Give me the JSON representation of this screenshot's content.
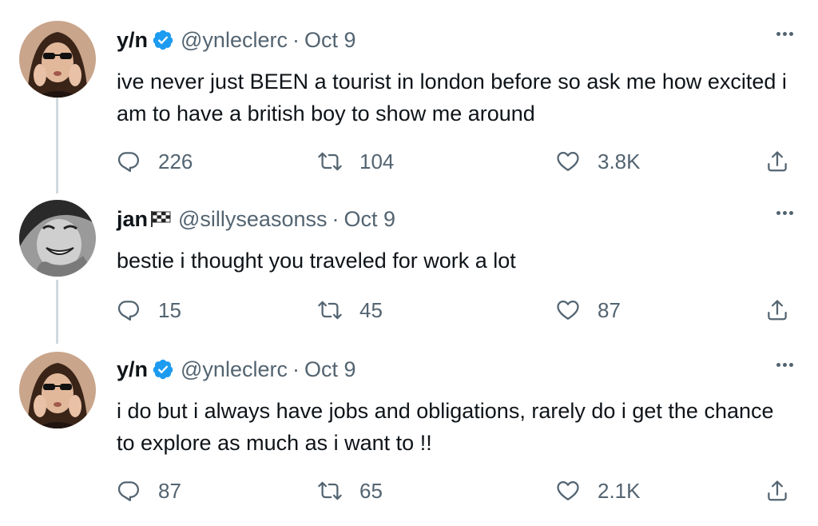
{
  "tweets": [
    {
      "name": "y/n",
      "handle": "@ynleclerc",
      "dot": "·",
      "date": "Oct 9",
      "verified": true,
      "text": "ive never just BEEN a tourist in london before so ask me how excited i am to have a british boy to show me around",
      "replies": "226",
      "retweets": "104",
      "likes": "3.8K"
    },
    {
      "name": "jan",
      "name_suffix_icon": "checkered-flag-icon",
      "handle": "@sillyseasonss",
      "dot": "·",
      "date": "Oct 9",
      "verified": false,
      "text": "bestie i thought you traveled for work a lot",
      "replies": "15",
      "retweets": "45",
      "likes": "87"
    },
    {
      "name": "y/n",
      "handle": "@ynleclerc",
      "dot": "·",
      "date": "Oct 9",
      "verified": true,
      "text": "i do but i always have jobs and obligations, rarely do i get the chance to explore as much as i want to !!",
      "replies": "87",
      "retweets": "65",
      "likes": "2.1K"
    }
  ],
  "colors": {
    "text": "#0f1419",
    "secondary": "#536471",
    "verified": "#1d9bf0",
    "thread_line": "#cfd9de"
  },
  "icons": [
    "reply-icon",
    "retweet-icon",
    "like-icon",
    "share-icon",
    "more-icon",
    "verified-icon"
  ]
}
